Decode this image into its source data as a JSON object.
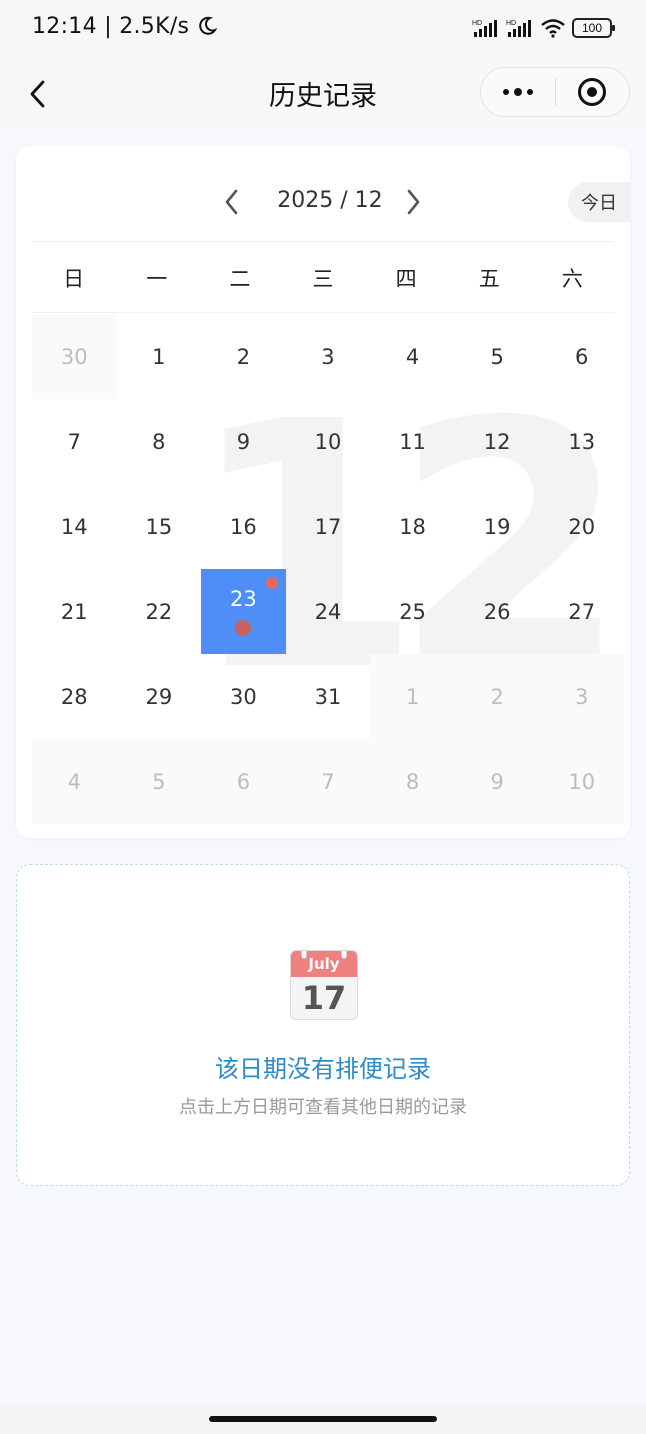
{
  "status_bar": {
    "time": "12:14 | 2.5K/s",
    "moon_icon": "moon-icon",
    "signal_icon_1": "signal-hd-icon",
    "signal_icon_2": "signal-hd-icon",
    "wifi_icon": "wifi-icon",
    "battery": "100"
  },
  "nav": {
    "title": "历史记录",
    "back_icon": "chevron-left-icon",
    "more_icon": "more-dots-icon",
    "close_icon": "target-icon"
  },
  "calendar": {
    "month_label": "2025 / 12",
    "today_label": "今日",
    "watermark": "12",
    "weekdays": [
      "日",
      "一",
      "二",
      "三",
      "四",
      "五",
      "六"
    ],
    "days": [
      {
        "label": "30",
        "state": "other"
      },
      {
        "label": "1",
        "state": "current"
      },
      {
        "label": "2",
        "state": "current"
      },
      {
        "label": "3",
        "state": "current"
      },
      {
        "label": "4",
        "state": "current"
      },
      {
        "label": "5",
        "state": "current"
      },
      {
        "label": "6",
        "state": "current"
      },
      {
        "label": "7",
        "state": "current"
      },
      {
        "label": "8",
        "state": "current"
      },
      {
        "label": "9",
        "state": "current"
      },
      {
        "label": "10",
        "state": "current"
      },
      {
        "label": "11",
        "state": "current"
      },
      {
        "label": "12",
        "state": "current"
      },
      {
        "label": "13",
        "state": "current"
      },
      {
        "label": "14",
        "state": "current"
      },
      {
        "label": "15",
        "state": "current"
      },
      {
        "label": "16",
        "state": "current"
      },
      {
        "label": "17",
        "state": "current"
      },
      {
        "label": "18",
        "state": "current"
      },
      {
        "label": "19",
        "state": "current"
      },
      {
        "label": "20",
        "state": "current"
      },
      {
        "label": "21",
        "state": "current"
      },
      {
        "label": "22",
        "state": "current"
      },
      {
        "label": "23",
        "state": "selected"
      },
      {
        "label": "24",
        "state": "current"
      },
      {
        "label": "25",
        "state": "current"
      },
      {
        "label": "26",
        "state": "current"
      },
      {
        "label": "27",
        "state": "current"
      },
      {
        "label": "28",
        "state": "current"
      },
      {
        "label": "29",
        "state": "current"
      },
      {
        "label": "30",
        "state": "current"
      },
      {
        "label": "31",
        "state": "current"
      },
      {
        "label": "1",
        "state": "other"
      },
      {
        "label": "2",
        "state": "other"
      },
      {
        "label": "3",
        "state": "other"
      },
      {
        "label": "4",
        "state": "other"
      },
      {
        "label": "5",
        "state": "other"
      },
      {
        "label": "6",
        "state": "other"
      },
      {
        "label": "7",
        "state": "other"
      },
      {
        "label": "8",
        "state": "other"
      },
      {
        "label": "9",
        "state": "other"
      },
      {
        "label": "10",
        "state": "other"
      }
    ]
  },
  "empty_state": {
    "icon_month": "July",
    "icon_day": "17",
    "title": "该日期没有排便记录",
    "subtitle": "点击上方日期可查看其他日期的记录"
  }
}
